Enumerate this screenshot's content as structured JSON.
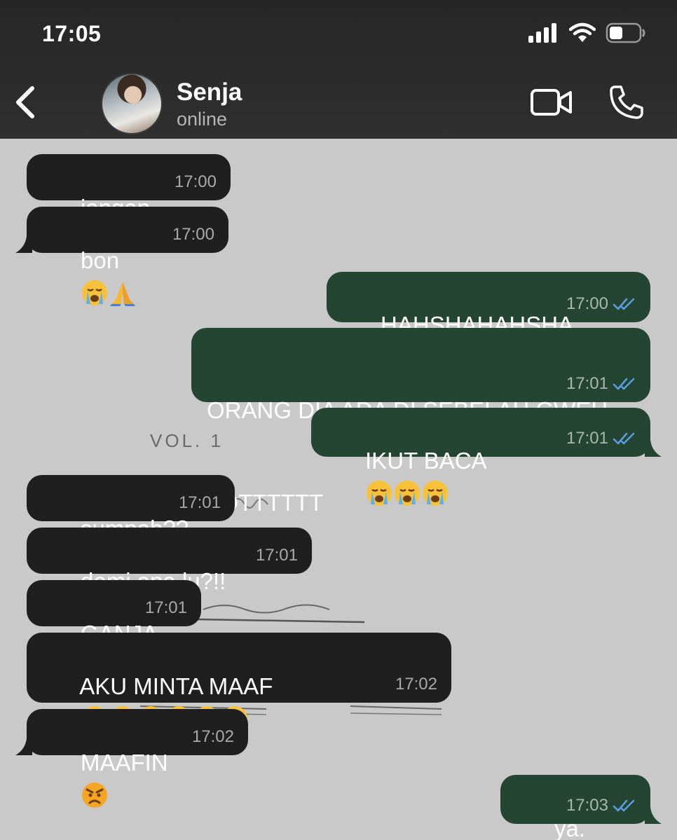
{
  "status_bar": {
    "time": "17:05"
  },
  "header": {
    "contact_name": "Senja",
    "contact_status": "online"
  },
  "messages": [
    {
      "direction": "in",
      "text": "jangan",
      "emojis": [
        "crying-face"
      ],
      "time": "17:00"
    },
    {
      "direction": "in",
      "text": "bon",
      "emojis": [
        "crying-face",
        "folded-hands"
      ],
      "time": "17:00"
    },
    {
      "direction": "out",
      "text": "HAHSHAHAHSHA",
      "emojis": [],
      "time": "17:00",
      "read": true
    },
    {
      "direction": "out",
      "text_line1": "ORANG DIA ADA DI SEBELAH GWEH",
      "text_line2": "TOTTTTTT",
      "emojis": [],
      "time": "17:01",
      "read": true
    },
    {
      "direction": "out",
      "text": "IKUT BACA",
      "emojis": [
        "crying-face",
        "crying-face",
        "crying-face"
      ],
      "time": "17:01",
      "read": true
    },
    {
      "direction": "in",
      "text": "sumpah??",
      "emojis": [],
      "time": "17:01"
    },
    {
      "direction": "in",
      "text": "demi apa lu?!!",
      "emojis": [
        "crying-face"
      ],
      "time": "17:01"
    },
    {
      "direction": "in",
      "text": "GANJA",
      "emojis": [],
      "time": "17:01"
    },
    {
      "direction": "in",
      "text": "AKU MINTA MAAF",
      "emojis": [
        "crying-face",
        "crying-face",
        "crying-face",
        "crying-face",
        "crying-face",
        "crying-face"
      ],
      "time": "17:02"
    },
    {
      "direction": "in",
      "text": "MAAFIN",
      "emojis": [
        "angry-face"
      ],
      "time": "17:02"
    },
    {
      "direction": "out",
      "text": "ya.",
      "emojis": [],
      "time": "17:03",
      "read": true
    }
  ],
  "wallpaper_text": {
    "vol": "VOL. 1"
  },
  "colors": {
    "header_bg": "#2b2c2b",
    "chat_bg": "#c9c9c9",
    "incoming_bubble": "#1f1f1f",
    "outgoing_bubble": "#244532",
    "read_tick": "#5b9fe0"
  }
}
